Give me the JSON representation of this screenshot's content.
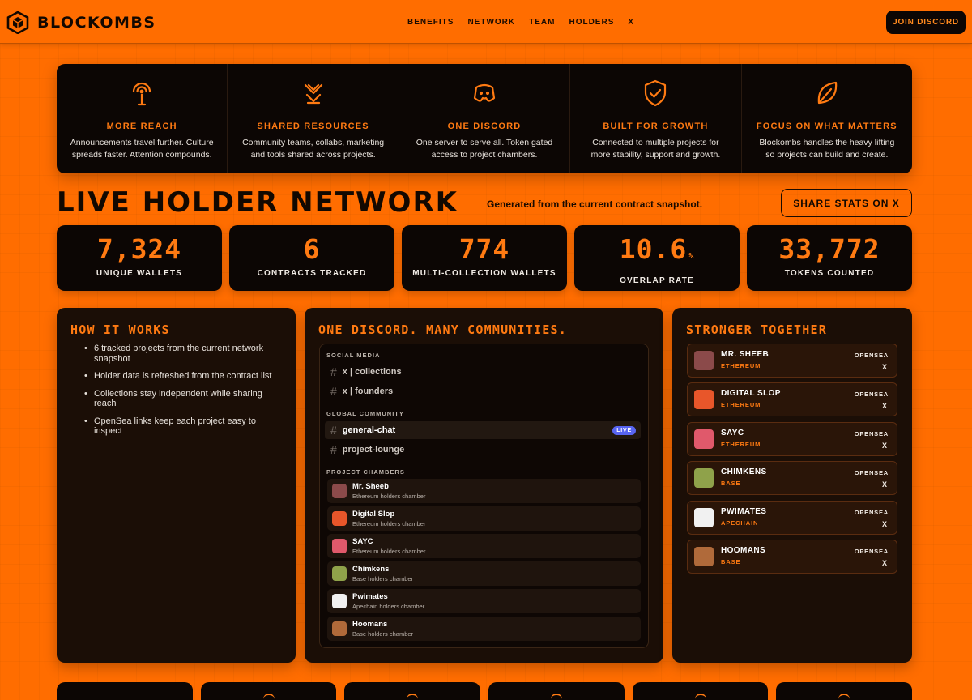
{
  "nav": {
    "brand": "BLOCKOMBS",
    "links": [
      "BENEFITS",
      "NETWORK",
      "TEAM",
      "HOLDERS",
      "X"
    ],
    "join_label": "JOIN DISCORD"
  },
  "benefits": [
    {
      "icon": "broadcast-icon",
      "title": "MORE REACH",
      "desc": "Announcements travel further. Culture spreads faster. Attention compounds."
    },
    {
      "icon": "shared-resources-icon",
      "title": "SHARED RESOURCES",
      "desc": "Community teams, collabs, marketing and tools shared across projects."
    },
    {
      "icon": "discord-icon",
      "title": "ONE DISCORD",
      "desc": "One server to serve all. Token gated access to project chambers."
    },
    {
      "icon": "shield-check-icon",
      "title": "BUILT FOR GROWTH",
      "desc": "Connected to multiple projects for more stability, support and growth."
    },
    {
      "icon": "leaf-icon",
      "title": "FOCUS ON WHAT MATTERS",
      "desc": "Blockombs handles the heavy lifting so projects can build and create."
    }
  ],
  "live": {
    "title": "LIVE HOLDER NETWORK",
    "subtitle": "Generated from the current contract snapshot.",
    "share_label": "SHARE STATS ON X"
  },
  "stats": [
    {
      "value": "7,324",
      "unit": "",
      "label": "UNIQUE WALLETS"
    },
    {
      "value": "6",
      "unit": "",
      "label": "CONTRACTS TRACKED"
    },
    {
      "value": "774",
      "unit": "",
      "label": "MULTI-COLLECTION WALLETS"
    },
    {
      "value": "10.6",
      "unit": "%",
      "label": "OVERLAP RATE"
    },
    {
      "value": "33,772",
      "unit": "",
      "label": "TOKENS COUNTED"
    }
  ],
  "how": {
    "title": "HOW IT WORKS",
    "items": [
      "6 tracked projects from the current network snapshot",
      "Holder data is refreshed from the contract list",
      "Collections stay independent while sharing reach",
      "OpenSea links keep each project easy to inspect"
    ]
  },
  "discord": {
    "title": "ONE DISCORD. MANY COMMUNITIES.",
    "sections": {
      "social": "SOCIAL MEDIA",
      "global": "GLOBAL COMMUNITY",
      "chambers": "PROJECT CHAMBERS"
    },
    "social_channels": [
      "x | collections",
      "x | founders"
    ],
    "global_channels": [
      "general-chat",
      "project-lounge"
    ],
    "live_badge": "LIVE",
    "chambers": [
      {
        "name": "Mr. Sheeb",
        "sub": "Ethereum holders chamber",
        "color": "#8b4a4a"
      },
      {
        "name": "Digital Slop",
        "sub": "Ethereum holders chamber",
        "color": "#e8562a"
      },
      {
        "name": "SAYC",
        "sub": "Ethereum holders chamber",
        "color": "#e0596b"
      },
      {
        "name": "Chimkens",
        "sub": "Base holders chamber",
        "color": "#8fa24a"
      },
      {
        "name": "Pwimates",
        "sub": "Apechain holders chamber",
        "color": "#f1f1f1"
      },
      {
        "name": "Hoomans",
        "sub": "Base holders chamber",
        "color": "#b06a3a"
      }
    ]
  },
  "strong": {
    "title": "STRONGER TOGETHER",
    "opensea": "OPENSEA",
    "x": "X",
    "projects": [
      {
        "name": "MR. SHEEB",
        "chain": "ETHEREUM",
        "color": "#8b4a4a"
      },
      {
        "name": "DIGITAL SLOP",
        "chain": "ETHEREUM",
        "color": "#e8562a"
      },
      {
        "name": "SAYC",
        "chain": "ETHEREUM",
        "color": "#e0596b"
      },
      {
        "name": "CHIMKENS",
        "chain": "BASE",
        "color": "#8fa24a"
      },
      {
        "name": "PWIMATES",
        "chain": "APECHAIN",
        "color": "#f1f1f1"
      },
      {
        "name": "HOOMANS",
        "chain": "BASE",
        "color": "#b06a3a"
      }
    ]
  },
  "colors": {
    "accent": "#ff7a12",
    "page": "#ff6d00",
    "card": "#0c0604",
    "live_badge": "#5865f2"
  }
}
